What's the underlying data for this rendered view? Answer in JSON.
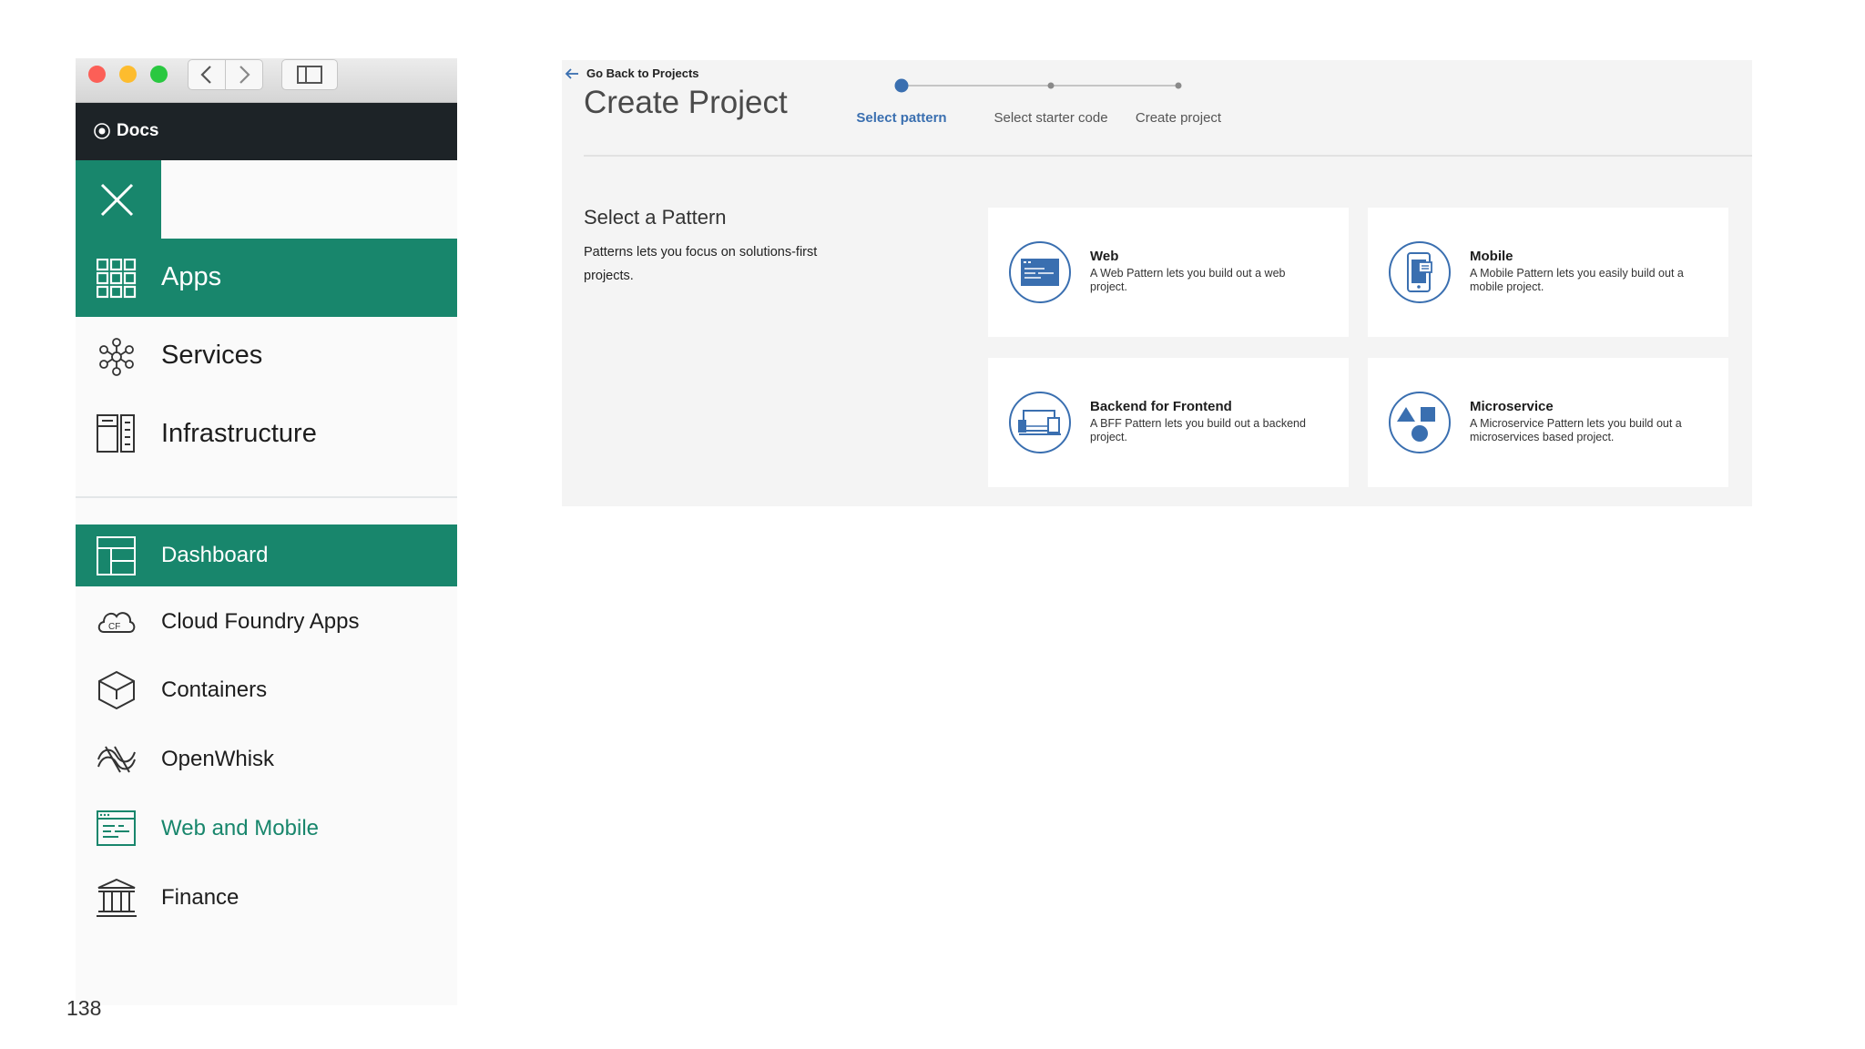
{
  "sidebar": {
    "docs_label": "Docs",
    "primary_items": [
      {
        "label": "Apps",
        "icon": "grid-icon",
        "active": true
      },
      {
        "label": "Services",
        "icon": "services-icon",
        "active": false
      },
      {
        "label": "Infrastructure",
        "icon": "infrastructure-icon",
        "active": false
      }
    ],
    "secondary_items": [
      {
        "label": "Dashboard",
        "icon": "dashboard-icon",
        "active": true
      },
      {
        "label": "Cloud Foundry Apps",
        "icon": "cloud-foundry-icon",
        "active": false
      },
      {
        "label": "Containers",
        "icon": "containers-icon",
        "active": false
      },
      {
        "label": "OpenWhisk",
        "icon": "openwhisk-icon",
        "active": false
      },
      {
        "label": "Web and Mobile",
        "icon": "web-and-mobile-icon",
        "active": false,
        "highlighted": true
      },
      {
        "label": "Finance",
        "icon": "finance-icon",
        "active": false
      }
    ]
  },
  "create_project": {
    "back_link": "Go Back to Projects",
    "title": "Create Project",
    "steps": [
      {
        "label": "Select pattern",
        "active": true
      },
      {
        "label": "Select starter code",
        "active": false
      },
      {
        "label": "Create project",
        "active": false
      }
    ],
    "section_title": "Select a Pattern",
    "section_description": "Patterns lets you focus on solutions-first projects.",
    "patterns": [
      {
        "title": "Web",
        "description": "A Web Pattern lets you build out a web project.",
        "icon": "web-pattern-icon"
      },
      {
        "title": "Mobile",
        "description": "A Mobile Pattern lets you easily build out a mobile project.",
        "icon": "mobile-pattern-icon"
      },
      {
        "title": "Backend for Frontend",
        "description": "A BFF Pattern lets you build out a backend project.",
        "icon": "backend-pattern-icon"
      },
      {
        "title": "Microservice",
        "description": "A Microservice Pattern lets you build out a microservices based project.",
        "icon": "microservice-pattern-icon"
      }
    ]
  },
  "page_number": "138",
  "colors": {
    "accent_green": "#18866c",
    "accent_blue": "#3a6fb0",
    "dark_bar": "#1d2327",
    "panel_bg": "#f4f4f4"
  }
}
